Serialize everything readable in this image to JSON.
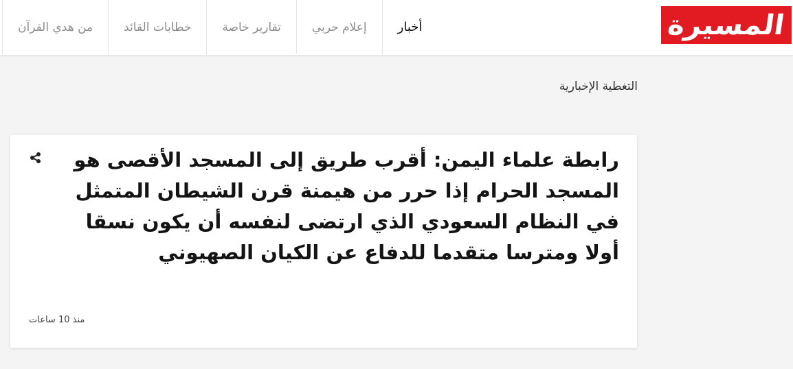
{
  "logo": {
    "text": "المسيرة",
    "color": "#e21b23"
  },
  "nav": {
    "items": [
      {
        "label": "أخبار",
        "active": true
      },
      {
        "label": "إعلام حربي",
        "active": false
      },
      {
        "label": "تقارير خاصة",
        "active": false
      },
      {
        "label": "خطابات القائد",
        "active": false
      },
      {
        "label": "من هدي القرآن",
        "active": false
      }
    ]
  },
  "section": {
    "title": "التغطية الإخبارية"
  },
  "article": {
    "headline": "رابطة علماء اليمن: أقرب طريق إلى المسجد الأقصى هو المسجد الحرام إذا حرر من هيمنة قرن الشيطان المتمثل في النظام السعودي الذي ارتضى لنفسه أن يكون نسقا أولا ومترسا متقدما للدفاع عن الكيان الصهيوني",
    "time": "منذ 10 ساعات",
    "share_icon": "share-icon"
  }
}
